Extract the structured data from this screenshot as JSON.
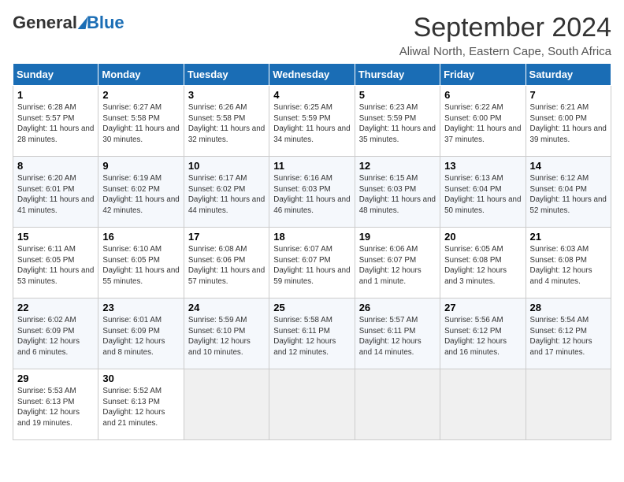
{
  "header": {
    "logo_general": "General",
    "logo_blue": "Blue",
    "month_title": "September 2024",
    "location": "Aliwal North, Eastern Cape, South Africa"
  },
  "weekdays": [
    "Sunday",
    "Monday",
    "Tuesday",
    "Wednesday",
    "Thursday",
    "Friday",
    "Saturday"
  ],
  "weeks": [
    [
      {
        "day": "1",
        "sunrise": "6:28 AM",
        "sunset": "5:57 PM",
        "daylight": "11 hours and 28 minutes."
      },
      {
        "day": "2",
        "sunrise": "6:27 AM",
        "sunset": "5:58 PM",
        "daylight": "11 hours and 30 minutes."
      },
      {
        "day": "3",
        "sunrise": "6:26 AM",
        "sunset": "5:58 PM",
        "daylight": "11 hours and 32 minutes."
      },
      {
        "day": "4",
        "sunrise": "6:25 AM",
        "sunset": "5:59 PM",
        "daylight": "11 hours and 34 minutes."
      },
      {
        "day": "5",
        "sunrise": "6:23 AM",
        "sunset": "5:59 PM",
        "daylight": "11 hours and 35 minutes."
      },
      {
        "day": "6",
        "sunrise": "6:22 AM",
        "sunset": "6:00 PM",
        "daylight": "11 hours and 37 minutes."
      },
      {
        "day": "7",
        "sunrise": "6:21 AM",
        "sunset": "6:00 PM",
        "daylight": "11 hours and 39 minutes."
      }
    ],
    [
      {
        "day": "8",
        "sunrise": "6:20 AM",
        "sunset": "6:01 PM",
        "daylight": "11 hours and 41 minutes."
      },
      {
        "day": "9",
        "sunrise": "6:19 AM",
        "sunset": "6:02 PM",
        "daylight": "11 hours and 42 minutes."
      },
      {
        "day": "10",
        "sunrise": "6:17 AM",
        "sunset": "6:02 PM",
        "daylight": "11 hours and 44 minutes."
      },
      {
        "day": "11",
        "sunrise": "6:16 AM",
        "sunset": "6:03 PM",
        "daylight": "11 hours and 46 minutes."
      },
      {
        "day": "12",
        "sunrise": "6:15 AM",
        "sunset": "6:03 PM",
        "daylight": "11 hours and 48 minutes."
      },
      {
        "day": "13",
        "sunrise": "6:13 AM",
        "sunset": "6:04 PM",
        "daylight": "11 hours and 50 minutes."
      },
      {
        "day": "14",
        "sunrise": "6:12 AM",
        "sunset": "6:04 PM",
        "daylight": "11 hours and 52 minutes."
      }
    ],
    [
      {
        "day": "15",
        "sunrise": "6:11 AM",
        "sunset": "6:05 PM",
        "daylight": "11 hours and 53 minutes."
      },
      {
        "day": "16",
        "sunrise": "6:10 AM",
        "sunset": "6:05 PM",
        "daylight": "11 hours and 55 minutes."
      },
      {
        "day": "17",
        "sunrise": "6:08 AM",
        "sunset": "6:06 PM",
        "daylight": "11 hours and 57 minutes."
      },
      {
        "day": "18",
        "sunrise": "6:07 AM",
        "sunset": "6:07 PM",
        "daylight": "11 hours and 59 minutes."
      },
      {
        "day": "19",
        "sunrise": "6:06 AM",
        "sunset": "6:07 PM",
        "daylight": "12 hours and 1 minute."
      },
      {
        "day": "20",
        "sunrise": "6:05 AM",
        "sunset": "6:08 PM",
        "daylight": "12 hours and 3 minutes."
      },
      {
        "day": "21",
        "sunrise": "6:03 AM",
        "sunset": "6:08 PM",
        "daylight": "12 hours and 4 minutes."
      }
    ],
    [
      {
        "day": "22",
        "sunrise": "6:02 AM",
        "sunset": "6:09 PM",
        "daylight": "12 hours and 6 minutes."
      },
      {
        "day": "23",
        "sunrise": "6:01 AM",
        "sunset": "6:09 PM",
        "daylight": "12 hours and 8 minutes."
      },
      {
        "day": "24",
        "sunrise": "5:59 AM",
        "sunset": "6:10 PM",
        "daylight": "12 hours and 10 minutes."
      },
      {
        "day": "25",
        "sunrise": "5:58 AM",
        "sunset": "6:11 PM",
        "daylight": "12 hours and 12 minutes."
      },
      {
        "day": "26",
        "sunrise": "5:57 AM",
        "sunset": "6:11 PM",
        "daylight": "12 hours and 14 minutes."
      },
      {
        "day": "27",
        "sunrise": "5:56 AM",
        "sunset": "6:12 PM",
        "daylight": "12 hours and 16 minutes."
      },
      {
        "day": "28",
        "sunrise": "5:54 AM",
        "sunset": "6:12 PM",
        "daylight": "12 hours and 17 minutes."
      }
    ],
    [
      {
        "day": "29",
        "sunrise": "5:53 AM",
        "sunset": "6:13 PM",
        "daylight": "12 hours and 19 minutes."
      },
      {
        "day": "30",
        "sunrise": "5:52 AM",
        "sunset": "6:13 PM",
        "daylight": "12 hours and 21 minutes."
      },
      null,
      null,
      null,
      null,
      null
    ]
  ]
}
